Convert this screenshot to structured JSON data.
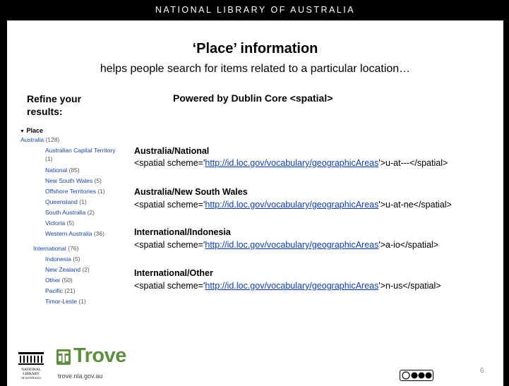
{
  "header": {
    "org": "NATIONAL LIBRARY OF AUSTRALIA"
  },
  "title": "‘Place’ information",
  "subtitle": "helps people search for items related to a particular location…",
  "refine": "Refine your results:",
  "powered": "Powered by Dublin Core <spatial>",
  "facets": {
    "heading": "Place",
    "australia": {
      "label": "Australia",
      "count": "(128)"
    },
    "act": {
      "label": "Australian Capital Territory",
      "count": "(1)"
    },
    "national": {
      "label": "National",
      "count": "(85)"
    },
    "nsw": {
      "label": "New South Wales",
      "count": "(5)"
    },
    "offshore": {
      "label": "Offshore Territories",
      "count": "(1)"
    },
    "qld": {
      "label": "Queensland",
      "count": "(1)"
    },
    "sa": {
      "label": "South Australia",
      "count": "(2)"
    },
    "vic": {
      "label": "Victoria",
      "count": "(5)"
    },
    "wa": {
      "label": "Western Australia",
      "count": "(36)"
    },
    "international": {
      "label": "International",
      "count": "(76)"
    },
    "indonesia": {
      "label": "Indonesia",
      "count": "(5)"
    },
    "nz": {
      "label": "New Zealand",
      "count": "(2)"
    },
    "other": {
      "label": "Other",
      "count": "(50)"
    },
    "pacific": {
      "label": "Pacific",
      "count": "(21)"
    },
    "timor": {
      "label": "Timor-Leste",
      "count": "(1)"
    }
  },
  "entries": [
    {
      "title": "Australia/National",
      "pre": "<spatial scheme='",
      "link": "http://id.loc.gov/vocabulary/geographicAreas",
      "post": "'>u-at---</spatial>"
    },
    {
      "title": "Australia/New South Wales",
      "pre": "<spatial scheme='",
      "link": "http://id.loc.gov/vocabulary/geographicAreas",
      "post": "'>u-at-ne</spatial>"
    },
    {
      "title": "International/Indonesia",
      "pre": "<spatial scheme='",
      "link": "http://id.loc.gov/vocabulary/geographicAreas",
      "post": "'>a-io</spatial>"
    },
    {
      "title": "International/Other",
      "pre": "<spatial scheme='",
      "link": "http://id.loc.gov/vocabulary/geographicAreas",
      "post": "'>n-us</spatial>"
    }
  ],
  "footer": {
    "nla_logo": [
      "NATIONAL",
      "LIBRARY",
      "OF AUSTRALIA"
    ],
    "trove": "Trove",
    "url": "trove.nla.gov.au",
    "page": "6",
    "license_icon": "creative-commons-icon"
  },
  "colors": {
    "link": "#0b3fc4",
    "facet_link": "#1a44b8",
    "trove_green": "#5d8f3e",
    "header_bg": "#000000"
  }
}
